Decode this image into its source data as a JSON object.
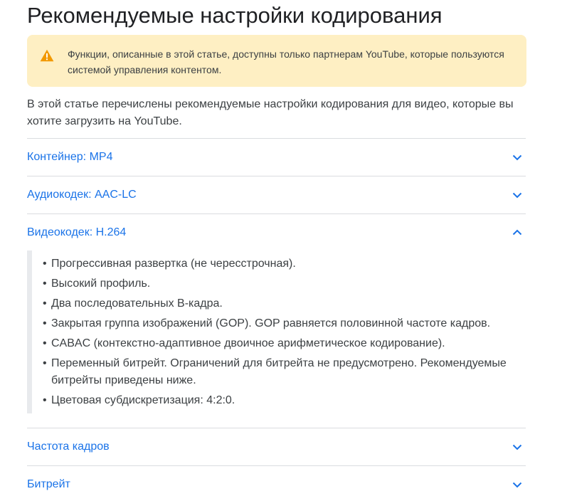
{
  "title": "Рекомендуемые настройки кодирования",
  "notice": {
    "icon": "warning-icon",
    "background": "#feefc3",
    "icon_color": "#f29900",
    "text": "Функции, описанные в этой статье, доступны только партнерам YouTube, которые пользуются системой управления контентом."
  },
  "intro": "В этой статье перечислены рекомендуемые настройки кодирования для видео, которые вы хотите загрузить на YouTube.",
  "accent_color": "#1a73e8",
  "sections": [
    {
      "label": "Контейнер: MP4",
      "expanded": false
    },
    {
      "label": "Аудиокодек: AAC-LC",
      "expanded": false
    },
    {
      "label": "Видеокодек: H.264",
      "expanded": true
    },
    {
      "label": "Частота кадров",
      "expanded": false
    },
    {
      "label": "Битрейт",
      "expanded": false
    }
  ],
  "video_codec_items": [
    "Прогрессивная развертка (не чересстрочная).",
    "Высокий профиль.",
    "Два последовательных B-кадра.",
    "Закрытая группа изображений (GOP). GOP равняется половинной частоте кадров.",
    "CABAC (контекстно-адаптивное двоичное арифметическое кодирование).",
    "Переменный битрейт. Ограничений для битрейта не предусмотрено. Рекомендуемые битрейты приведены ниже.",
    "Цветовая субдискретизация: 4:2:0."
  ]
}
